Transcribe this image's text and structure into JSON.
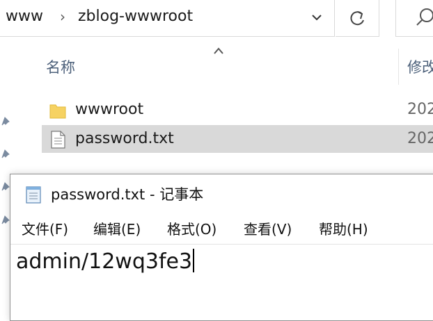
{
  "explorer": {
    "breadcrumb": {
      "items": [
        "www",
        "zblog-wwwroot"
      ],
      "separator": "›"
    },
    "columns": {
      "name": "名称",
      "modified": "修改"
    },
    "files": [
      {
        "name": "wwwroot",
        "icon": "folder-icon",
        "date": "202",
        "selected": false
      },
      {
        "name": "password.txt",
        "icon": "text-file-icon",
        "date": "202",
        "selected": true
      }
    ],
    "pins": 4
  },
  "notepad": {
    "title": "password.txt - 记事本",
    "menu": [
      "文件(F)",
      "编辑(E)",
      "格式(O)",
      "查看(V)",
      "帮助(H)"
    ],
    "content": "admin/12wq3fe3"
  },
  "colors": {
    "selected_row": "#d9d9d9",
    "header_text": "#4c607a",
    "folder": "#f6d262"
  }
}
